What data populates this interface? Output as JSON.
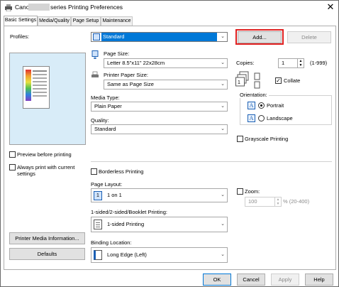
{
  "window": {
    "title_prefix": "Canon",
    "title_suffix": "series Printing Preferences",
    "close_glyph": "✕"
  },
  "tabs": [
    {
      "label": "Basic Settings"
    },
    {
      "label": "Media/Quality"
    },
    {
      "label": "Page Setup"
    },
    {
      "label": "Maintenance"
    }
  ],
  "profiles": {
    "label": "Profiles:",
    "value": "Standard",
    "add_label": "Add...",
    "delete_label": "Delete"
  },
  "page_size": {
    "label": "Page Size:",
    "value": "Letter 8.5\"x11\" 22x28cm"
  },
  "printer_paper_size": {
    "label": "Printer Paper Size:",
    "value": "Same as Page Size"
  },
  "media_type": {
    "label": "Media Type:",
    "value": "Plain Paper"
  },
  "quality": {
    "label": "Quality:",
    "value": "Standard"
  },
  "copies": {
    "label": "Copies:",
    "value": "1",
    "range": "(1-999)"
  },
  "collate": {
    "label": "Collate",
    "checked": true
  },
  "orientation": {
    "label": "Orientation:",
    "portrait": "Portrait",
    "landscape": "Landscape",
    "selected": "portrait"
  },
  "grayscale": {
    "label": "Grayscale Printing",
    "checked": false
  },
  "preview_before": {
    "label": "Preview before printing",
    "checked": false
  },
  "always_print": {
    "line1": "Always print with current",
    "line2": "settings",
    "checked": false
  },
  "borderless": {
    "label": "Borderless Printing",
    "checked": false
  },
  "page_layout": {
    "label": "Page Layout:",
    "value": "1 on 1",
    "icon_text": "1"
  },
  "zoom": {
    "label": "Zoom:",
    "value": "100",
    "range": "% (20-400)",
    "checked": false
  },
  "duplex": {
    "label": "1-sided/2-sided/Booklet Printing:",
    "value": "1-sided Printing"
  },
  "binding": {
    "label": "Binding Location:",
    "value": "Long Edge (Left)"
  },
  "printer_media_info_label": "Printer Media Information...",
  "defaults_label": "Defaults",
  "footer": {
    "ok": "OK",
    "cancel": "Cancel",
    "apply": "Apply",
    "help": "Help"
  },
  "colors": {
    "highlight_border": "#e02020",
    "selected_blue": "#0078d7"
  }
}
